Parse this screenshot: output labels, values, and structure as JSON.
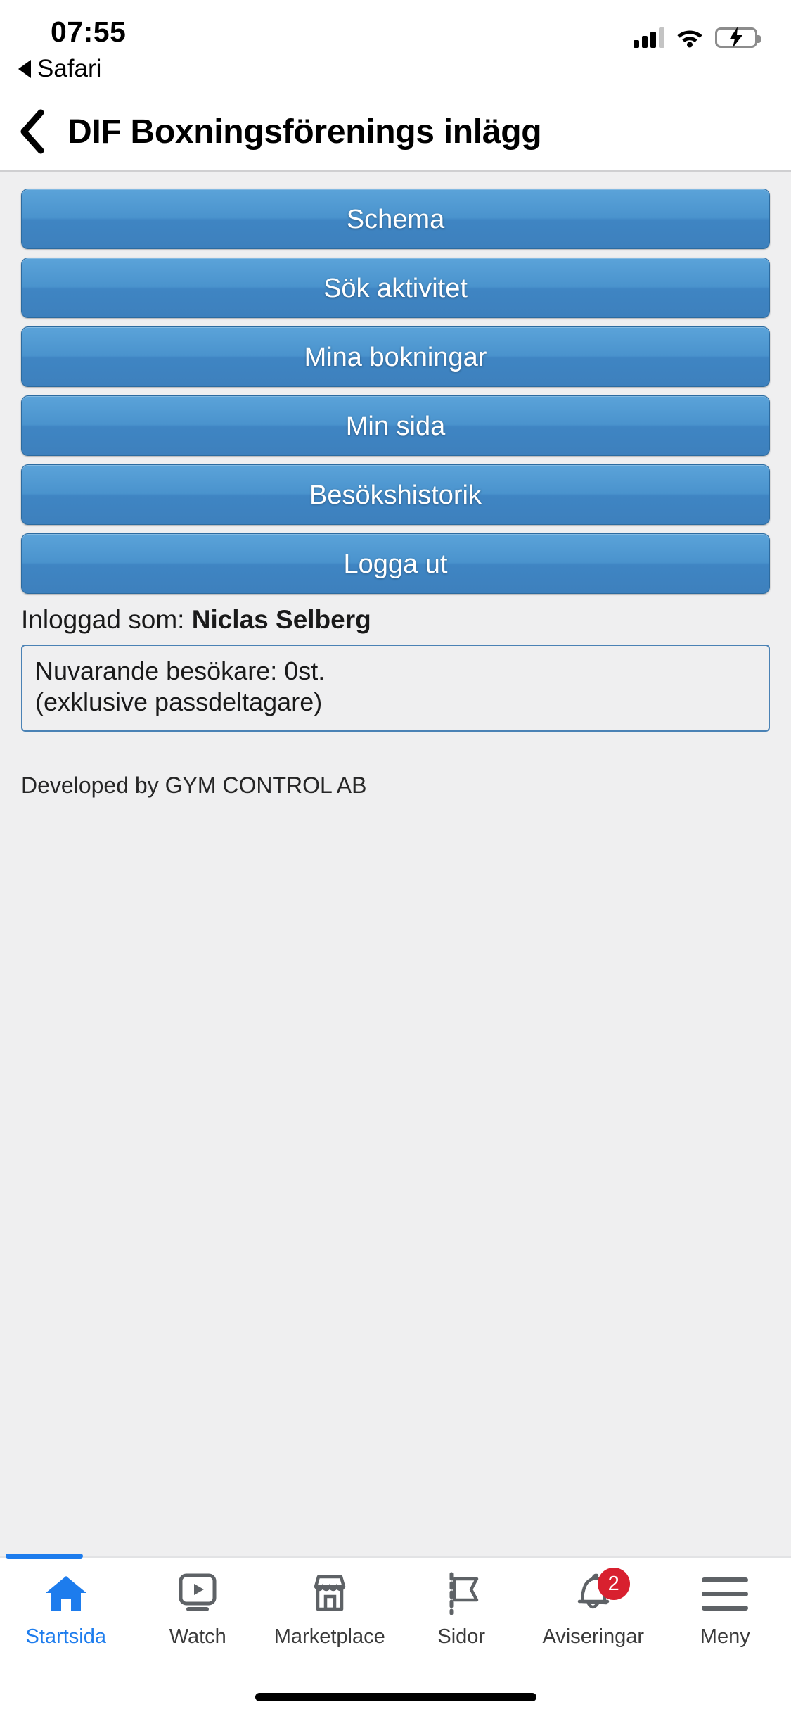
{
  "status_bar": {
    "time": "07:55",
    "back_to_app_label": "Safari",
    "signal_icon": "cellular-signal-icon",
    "wifi_icon": "wifi-icon",
    "battery_icon": "battery-charging-icon"
  },
  "nav_bar": {
    "back_icon": "chevron-left-icon",
    "title": "DIF Boxningsförenings inlägg"
  },
  "web_content": {
    "buttons": [
      {
        "label": "Schema"
      },
      {
        "label": "Sök aktivitet"
      },
      {
        "label": "Mina bokningar"
      },
      {
        "label": "Min sida"
      },
      {
        "label": "Besökshistorik"
      },
      {
        "label": "Logga ut"
      }
    ],
    "logged_in_prefix": "Inloggad som:",
    "logged_in_user": "Niclas Selberg",
    "info_box": {
      "line1": "Nuvarande besökare: 0st.",
      "line2": "(exklusive passdeltagare)"
    },
    "footer": "Developed by GYM CONTROL AB",
    "button_color": "#4a93cd",
    "button_border_color": "#2c6ba0",
    "info_box_border_color": "#4a82b5",
    "background_color": "#efeff0"
  },
  "tab_bar": {
    "active_color": "#1d7ced",
    "inactive_color": "#3b3b3b",
    "badge_color": "#d8202f",
    "items": [
      {
        "label": "Startsida",
        "icon": "home-icon",
        "active": true,
        "badge": ""
      },
      {
        "label": "Watch",
        "icon": "watch-video-icon",
        "active": false,
        "badge": ""
      },
      {
        "label": "Marketplace",
        "icon": "marketplace-storefront-icon",
        "active": false,
        "badge": ""
      },
      {
        "label": "Sidor",
        "icon": "pages-flag-icon",
        "active": false,
        "badge": ""
      },
      {
        "label": "Aviseringar",
        "icon": "bell-icon",
        "active": false,
        "badge": "2"
      },
      {
        "label": "Meny",
        "icon": "hamburger-menu-icon",
        "active": false,
        "badge": ""
      }
    ]
  }
}
